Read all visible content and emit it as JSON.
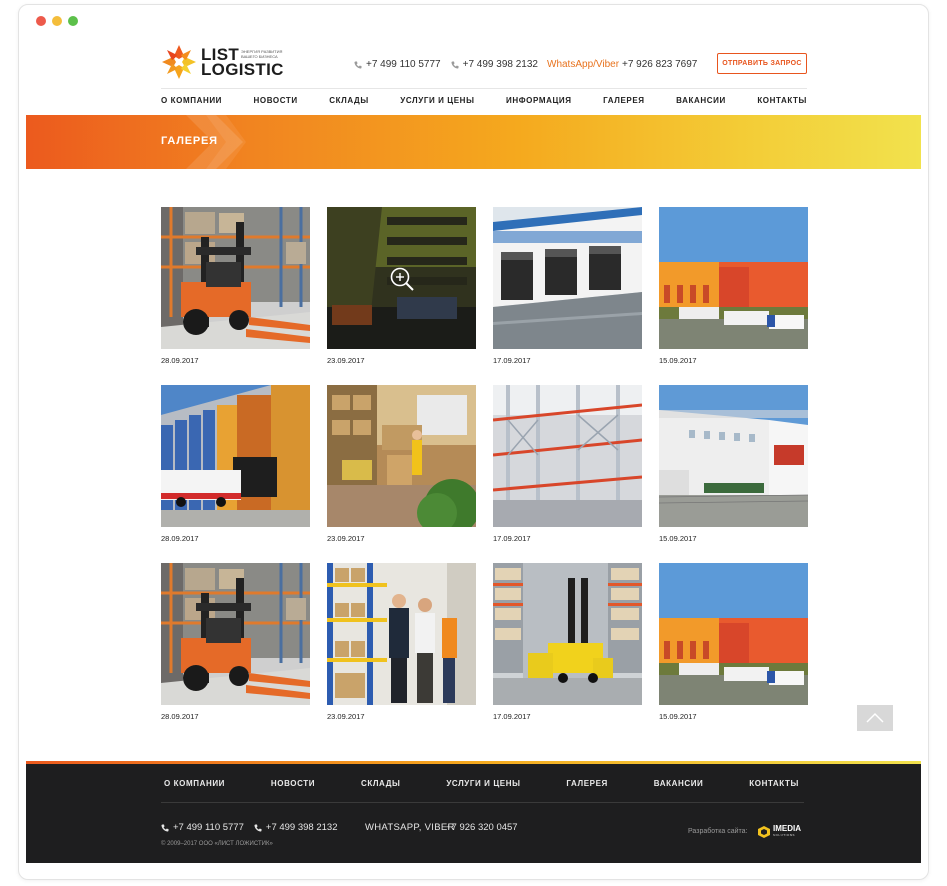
{
  "header": {
    "logo_line1": "LIST",
    "logo_line2": "LOGISTIC",
    "logo_tagline": "энергия развития вашего бизнеса",
    "phone1": "+7 499 110 5777",
    "phone2": "+7 499 398 2132",
    "whatsapp_label": "WhatsApp/Viber",
    "whatsapp_phone": "+7 926 823 7697",
    "request_button": "ОТПРАВИТЬ ЗАПРОС"
  },
  "nav": [
    "О КОМПАНИИ",
    "НОВОСТИ",
    "СКЛАДЫ",
    "УСЛУГИ И ЦЕНЫ",
    "ИНФОРМАЦИЯ",
    "ГАЛЕРЕЯ",
    "ВАКАНСИИ",
    "КОНТАКТЫ"
  ],
  "banner": {
    "title": "ГАЛЕРЕЯ"
  },
  "gallery": [
    {
      "date": "28.09.2017",
      "image": "forklift-warehouse"
    },
    {
      "date": "23.09.2017",
      "image": "automated-shelves"
    },
    {
      "date": "17.09.2017",
      "image": "loading-docks"
    },
    {
      "date": "15.09.2017",
      "image": "warehouse-exterior-trucks"
    },
    {
      "date": "28.09.2017",
      "image": "colorful-building-truck"
    },
    {
      "date": "23.09.2017",
      "image": "warehouse-workers"
    },
    {
      "date": "17.09.2017",
      "image": "steel-racks"
    },
    {
      "date": "15.09.2017",
      "image": "white-building"
    },
    {
      "date": "28.09.2017",
      "image": "forklift-warehouse"
    },
    {
      "date": "23.09.2017",
      "image": "business-people-shelves"
    },
    {
      "date": "17.09.2017",
      "image": "reach-trucks"
    },
    {
      "date": "15.09.2017",
      "image": "warehouse-exterior-trucks"
    }
  ],
  "footer": {
    "nav": [
      "О КОМПАНИИ",
      "НОВОСТИ",
      "СКЛАДЫ",
      "УСЛУГИ И ЦЕНЫ",
      "ГАЛЕРЕЯ",
      "ВАКАНСИИ",
      "КОНТАКТЫ"
    ],
    "phone1": "+7 499 110 5777",
    "phone2": "+7 499 398 2132",
    "whatsapp_label": "WHATSAPP, VIBER",
    "whatsapp_phone": "+7 926 320 0457",
    "copyright": "© 2009–2017 ООО «ЛИСТ ЛОЖИСТИК»",
    "developer_label": "Разработка сайта:",
    "developer_name": "IMEDIA",
    "developer_sub": "SOLUTIONS"
  },
  "colors": {
    "accent": "#e8551e",
    "banner_start": "#ec5a1e",
    "banner_end": "#f2e24d",
    "footer_bg": "#1e1e1f"
  }
}
